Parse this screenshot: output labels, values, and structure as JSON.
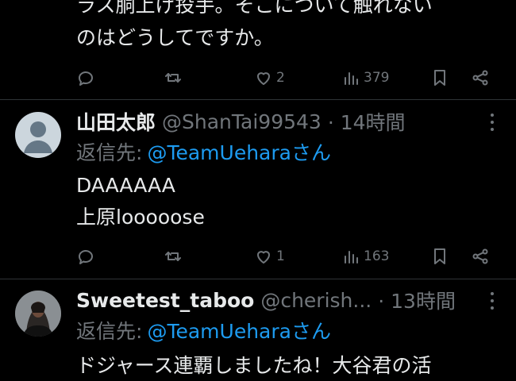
{
  "tweet1": {
    "text_line1": "ラス胴上げ投手。そこについて触れない",
    "text_line2": "のはどうしてですか。",
    "likes": "2",
    "views": "379"
  },
  "tweet2": {
    "name": "山田太郎",
    "handle": "@ShanTai99543",
    "time": "· 14時間",
    "reply_label": "返信先:",
    "reply_to": "@TeamUeharaさん",
    "text_line1": "DAAAAAA",
    "text_line2": "上原looooose",
    "likes": "1",
    "views": "163"
  },
  "tweet3": {
    "name": "Sweetest_taboo",
    "handle": "@cherish...",
    "time": "· 13時間",
    "reply_label": "返信先:",
    "reply_to": "@TeamUeharaさん",
    "text_line1": "ドジャース連覇しましたね！大谷君の活"
  },
  "colors": {
    "background": "#000000",
    "text": "#e7e9ea",
    "muted": "#71767b",
    "link": "#1d9bf0",
    "divider": "#2f3336"
  },
  "icons": [
    "reply-icon",
    "retweet-icon",
    "like-icon",
    "views-icon",
    "bookmark-icon",
    "share-icon",
    "more-icon"
  ]
}
